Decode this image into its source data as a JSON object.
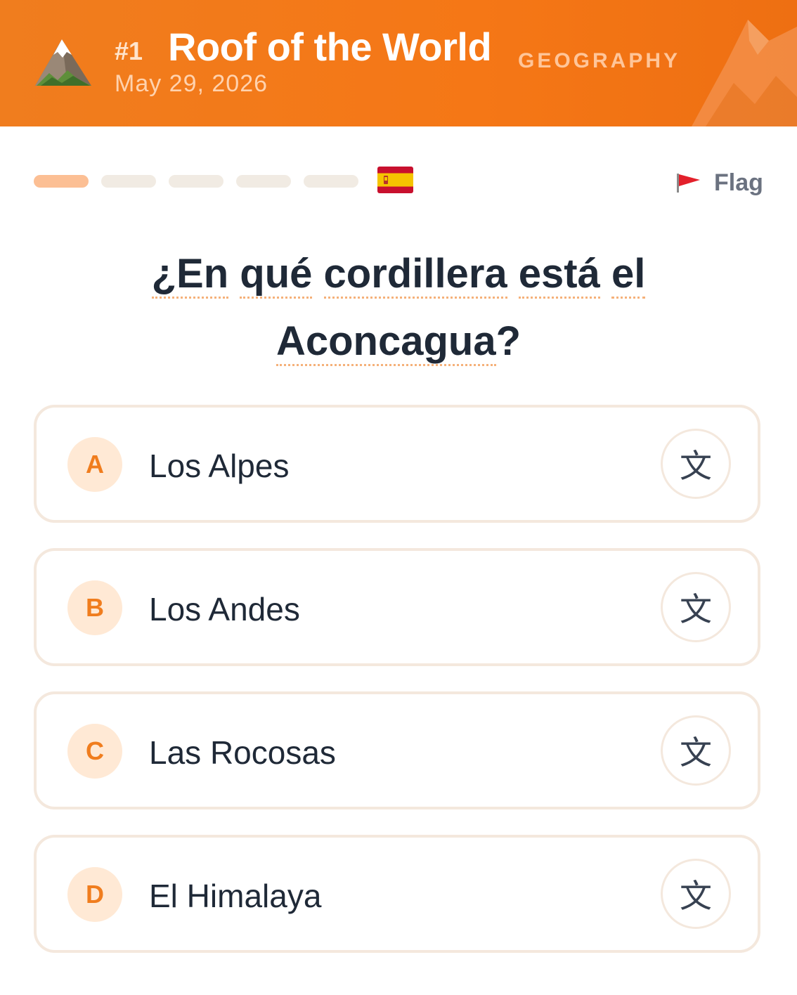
{
  "header": {
    "number": "#1",
    "title": "Roof of the World",
    "date": "May 29, 2026",
    "category": "GEOGRAPHY",
    "icon": "snow-capped-mountain-icon",
    "accent": "#f57716"
  },
  "progress": {
    "total": 5,
    "current": 1
  },
  "language": {
    "flag": "spain-flag-icon"
  },
  "flag_action": {
    "label": "Flag",
    "icon": "red-flag-icon"
  },
  "question": {
    "line1": [
      "¿En",
      "qué",
      "cordillera",
      "está",
      "el"
    ],
    "line2_word": "Aconcagua",
    "line2_punct": "?"
  },
  "options": [
    {
      "letter": "A",
      "text": "Los Alpes",
      "translate_glyph": "文"
    },
    {
      "letter": "B",
      "text": "Los Andes",
      "translate_glyph": "文"
    },
    {
      "letter": "C",
      "text": "Las Rocosas",
      "translate_glyph": "文"
    },
    {
      "letter": "D",
      "text": "El Himalaya",
      "translate_glyph": "文"
    }
  ]
}
